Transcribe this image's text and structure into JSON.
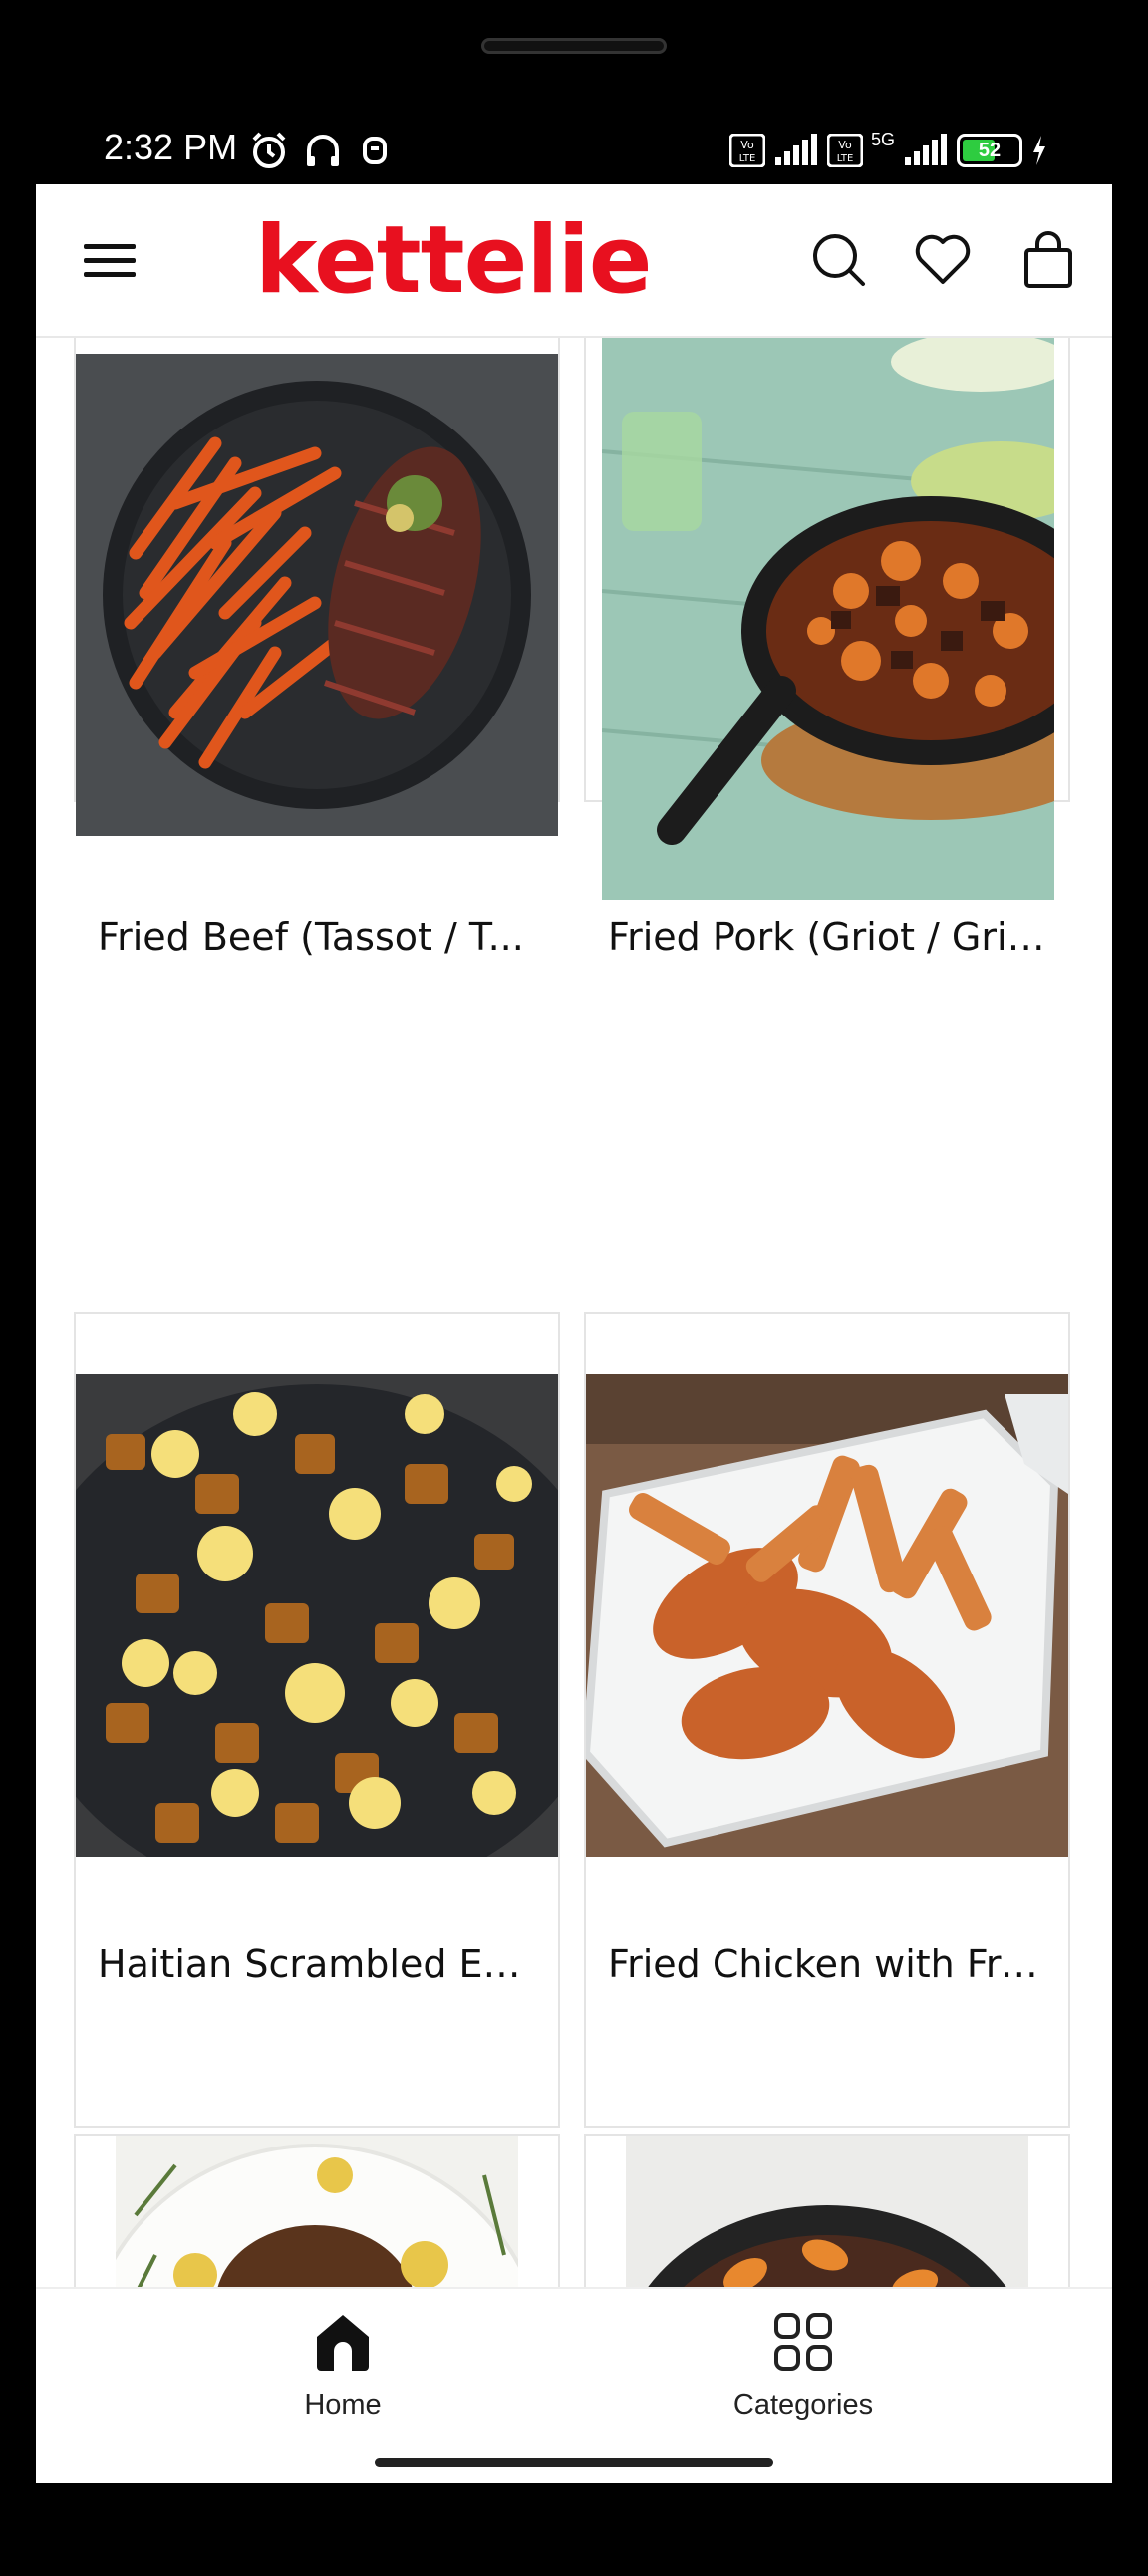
{
  "status": {
    "time": "2:32 PM",
    "network": "5G",
    "battery": "52"
  },
  "app": {
    "logo": "kettelie",
    "brand_color": "#e8101f"
  },
  "icons": {
    "menu": "hamburger-menu-icon",
    "search": "search-icon",
    "wishlist": "heart-icon",
    "cart": "shopping-bag-icon"
  },
  "products": [
    {
      "title": "Fried Beef (Tassot / T...",
      "image": "steak with sweet potato fries on dark plate"
    },
    {
      "title": "Fried Pork (Griot / Griy...",
      "image": "fried pork and sweet potatoes in cast iron skillet"
    },
    {
      "title": "Haitian Scrambled Eg...",
      "image": "scrambled eggs with fried potatoes in pan"
    },
    {
      "title": "Fried Chicken with Fre...",
      "image": "fried chicken wings with fries in takeout box"
    },
    {
      "title": "",
      "image": "roast chicken with potatoes and herbs"
    },
    {
      "title": "",
      "image": "beef cubes with sweet potatoes in skillet"
    }
  ],
  "bottom_nav": {
    "home_label": "Home",
    "categories_label": "Categories"
  }
}
